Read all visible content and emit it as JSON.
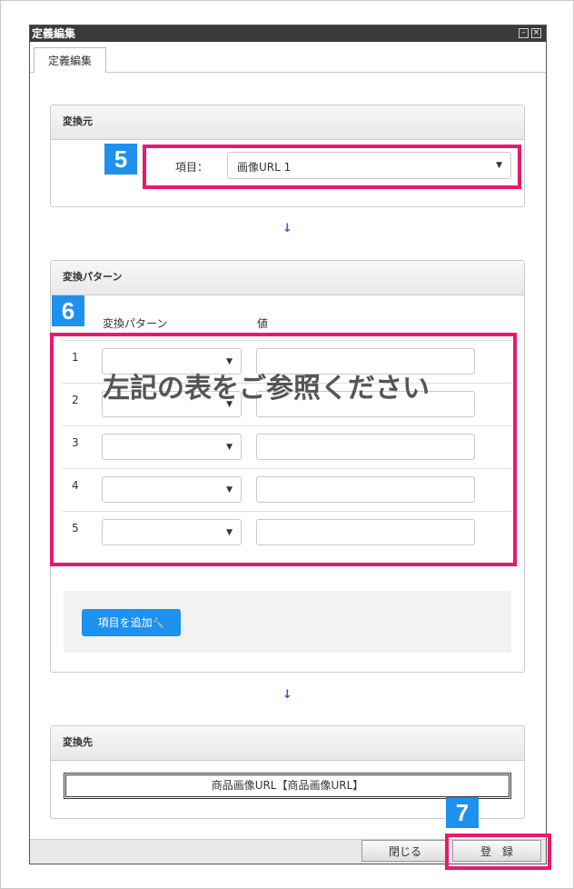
{
  "window": {
    "title": "定義編集",
    "minimize_icon": "minimize-icon",
    "close_icon": "close-icon"
  },
  "tab": {
    "label": "定義編集"
  },
  "source": {
    "header": "変換元",
    "field_label": "項目：",
    "field_value": "画像URL 1"
  },
  "pattern": {
    "header": "変換パターン",
    "col_pattern": "変換パターン",
    "col_value": "値",
    "rows": [
      {
        "num": "1",
        "pattern": "",
        "value": ""
      },
      {
        "num": "2",
        "pattern": "",
        "value": ""
      },
      {
        "num": "3",
        "pattern": "",
        "value": ""
      },
      {
        "num": "4",
        "pattern": "",
        "value": ""
      },
      {
        "num": "5",
        "pattern": "",
        "value": ""
      }
    ],
    "add_button": "項目を追加",
    "overlay_text": "左記の表をご参照ください"
  },
  "dest": {
    "header": "変換先",
    "value": "商品画像URL【商品画像URL】"
  },
  "footer": {
    "close_button": "閉じる",
    "register_button": "登　録"
  },
  "badges": {
    "b5": "5",
    "b6": "6",
    "b7": "7"
  },
  "colors": {
    "annotation_pink": "#e8196e",
    "annotation_blue": "#1e90ee",
    "arrow_blue": "#2a5bd7"
  }
}
